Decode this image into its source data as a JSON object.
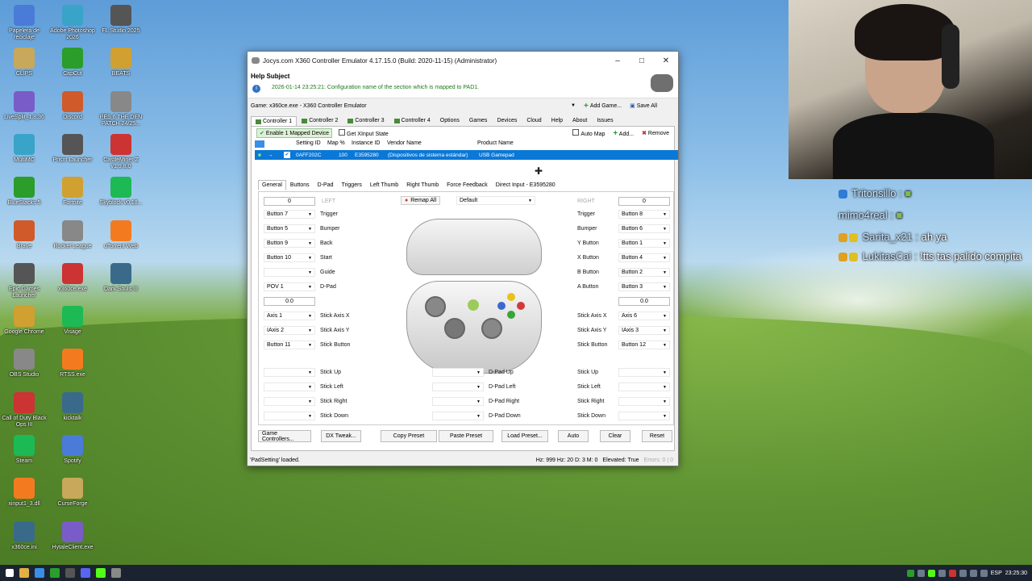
{
  "desktop": {
    "icons_col1": [
      "Papelera de reciclaje",
      "CLIPS",
      "LiveSplit_1.8.36",
      "MultiMC",
      "BlueStacks 5",
      "Brave",
      "Epic Games Launcher",
      "Google Chrome",
      "OBS Studio",
      "Call of Duty Black Ops III",
      "Steam",
      "xinput1_3.dll",
      "x360ce.ini"
    ],
    "icons_col2": [
      "Adobe Photoshop 2026",
      "CapCut",
      "Discord",
      "Prism Launcher",
      "Fortnite",
      "Rocket League",
      "x360ce.exe",
      "Visage",
      "RTSS.exe",
      "kicktalk",
      "Spotify",
      "CurseForge",
      "HytaleClient.exe"
    ],
    "icons_col3": [
      "FL Studio 2025",
      "BEATS",
      "PES 6 THE DEN PATCH 24/25...",
      "CastleMiner Z v1.9.8.0",
      "Skyblock v0.18...",
      "uTorrent Web",
      "Dark Souls III"
    ]
  },
  "chat": [
    {
      "user": "Tritonsillo :",
      "text": ""
    },
    {
      "user": "mimo4real :",
      "text": ""
    },
    {
      "user": "Sarita_x21 :",
      "text": "ah ya"
    },
    {
      "user": "LukitasCai :",
      "text": "!tts tas palido compita"
    }
  ],
  "window": {
    "title": "Jocys.com X360 Controller Emulator 4.17.15.0 (Build: 2020-11-15) (Administrator)",
    "help_subject": "Help Subject",
    "help_message": "2026-01-14 23:25:21: Configuration name of the section which is mapped to PAD1.",
    "game_label": "Game:",
    "game_value": "x360ce.exe - X360 Controller Emulator",
    "add_game": "Add Game...",
    "save_all": "Save All",
    "tabs": [
      "Controller 1",
      "Controller 2",
      "Controller 3",
      "Controller 4",
      "Options",
      "Games",
      "Devices",
      "Cloud",
      "Help",
      "About",
      "Issues"
    ],
    "enable_mapped": "Enable 1 Mapped Device",
    "get_xinput": "Get XInput State",
    "auto_map": "Auto Map",
    "add": "Add...",
    "remove": "Remove",
    "grid_headers": [
      "Setting ID",
      "Map %",
      "Instance ID",
      "Vendor Name",
      "Product Name"
    ],
    "grid_row": {
      "setting_id": "0AFF202C",
      "map": "100",
      "instance_id": "E3595280",
      "vendor": "(Dispositivos de sistema estándar)",
      "product": "USB Gamepad"
    },
    "subtabs": [
      "General",
      "Buttons",
      "D-Pad",
      "Triggers",
      "Left Thumb",
      "Right Thumb",
      "Force Feedback",
      "Direct Input - E3595280"
    ],
    "left_label": "LEFT",
    "right_label": "RIGHT",
    "left_deadzone": "0",
    "right_deadzone": "0",
    "remap_all": "Remap All",
    "preset": "Default",
    "left_rows": [
      {
        "value": "Button 7",
        "label": "Trigger"
      },
      {
        "value": "Button 5",
        "label": "Bumper"
      },
      {
        "value": "Button 9",
        "label": "Back"
      },
      {
        "value": "Button 10",
        "label": "Start"
      },
      {
        "value": "",
        "label": "Guide"
      },
      {
        "value": "POV 1",
        "label": "D-Pad"
      }
    ],
    "left_stick_dz": "0.0",
    "left_axes": [
      {
        "value": "Axis 1",
        "label": "Stick Axis X"
      },
      {
        "value": "IAxis 2",
        "label": "Stick Axis Y"
      },
      {
        "value": "Button 11",
        "label": "Stick Button"
      }
    ],
    "left_dirs": [
      "Stick Up",
      "Stick Left",
      "Stick Right",
      "Stick Down"
    ],
    "right_rows": [
      {
        "value": "Button 8",
        "label": "Trigger"
      },
      {
        "value": "Button 6",
        "label": "Bumper"
      },
      {
        "value": "Button 1",
        "label": "Y Button"
      },
      {
        "value": "Button 4",
        "label": "X Button"
      },
      {
        "value": "Button 2",
        "label": "B Button"
      },
      {
        "value": "Button 3",
        "label": "A Button"
      }
    ],
    "right_stick_dz": "0.0",
    "right_axes": [
      {
        "value": "Axis 6",
        "label": "Stick Axis X"
      },
      {
        "value": "IAxis 3",
        "label": "Stick Axis Y"
      },
      {
        "value": "Button 12",
        "label": "Stick Button"
      }
    ],
    "right_dirs": [
      "Stick Up",
      "Stick Left",
      "Stick Right",
      "Stick Down"
    ],
    "dpad_dirs": [
      "D-Pad Up",
      "D-Pad Left",
      "D-Pad Right",
      "D-Pad Down"
    ],
    "bottom_buttons": [
      "Game Controllers...",
      "DX Tweak...",
      "Copy Preset",
      "Paste Preset",
      "Load Preset...",
      "Auto",
      "Clear",
      "Reset"
    ],
    "status_left": "'PadSetting' loaded.",
    "status_right": "Hz: 999  Hz: 20  D: 3  M: 0",
    "elevated": "Elevated: True",
    "errors": "Errors: 0 | 0"
  },
  "taskbar": {
    "lang": "ESP",
    "time": "23:25:30"
  }
}
